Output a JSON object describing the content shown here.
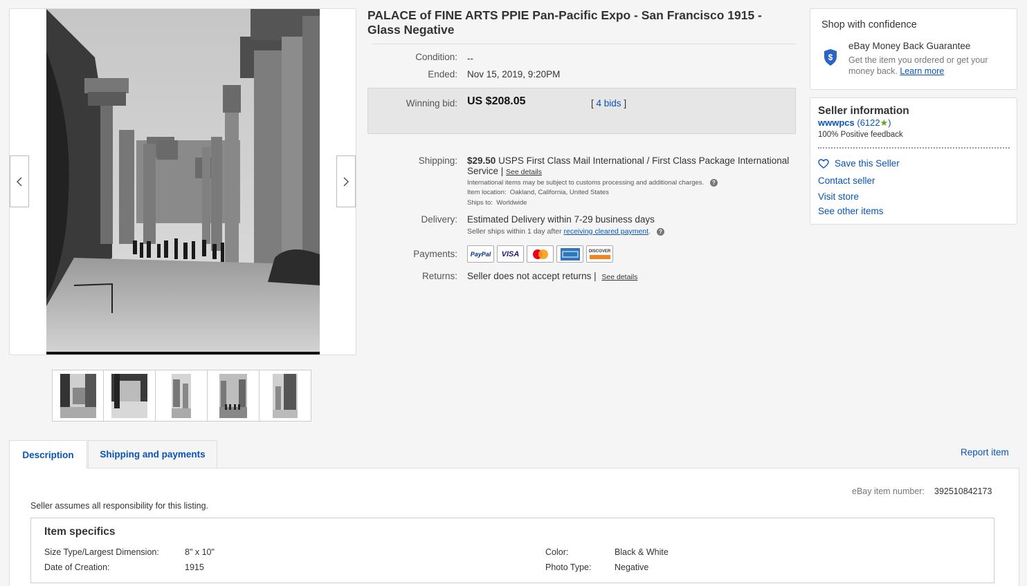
{
  "title": "PALACE of FINE ARTS PPIE Pan-Pacific Expo - San Francisco 1915 - Glass Negative",
  "details": {
    "condition_label": "Condition:",
    "condition_value": "--",
    "ended_label": "Ended:",
    "ended_value": "Nov 15, 2019, 9:20PM",
    "winning_bid_label": "Winning bid:",
    "winning_bid_value": "US $208.05",
    "bids_link": "4 bids",
    "bids_open": "[",
    "bids_close": "]",
    "shipping_label": "Shipping:",
    "shipping_cost": "$29.50",
    "shipping_service_line1": "USPS First Class Mail International / First Class Package International",
    "shipping_service_line2": "Service |",
    "shipping_see_details": "See details",
    "shipping_note": "International items may be subject to customs processing and additional charges.",
    "item_location_label": "Item location:",
    "item_location_value": "Oakland, California, United States",
    "ships_to_label": "Ships to:",
    "ships_to_value": "Worldwide",
    "delivery_label": "Delivery:",
    "delivery_value": "Estimated Delivery within 7-29 business days",
    "delivery_note_prefix": "Seller ships within 1 day after",
    "delivery_note_link": "receiving cleared payment",
    "delivery_note_suffix": ".",
    "payments_label": "Payments:",
    "returns_label": "Returns:",
    "returns_value": "Seller does not accept returns |",
    "returns_see_details": "See details"
  },
  "payments": [
    {
      "name": "PayPal",
      "icon": "paypal-icon",
      "color": "#003087"
    },
    {
      "name": "VISA",
      "icon": "visa-icon",
      "color": "#1a1f71"
    },
    {
      "name": "",
      "icon": "mastercard-icon",
      "color": "#eb001b"
    },
    {
      "name": "",
      "icon": "amex-icon",
      "color": "#2e77bb"
    },
    {
      "name": "DISCOVER",
      "icon": "discover-icon",
      "color": "#f58220"
    }
  ],
  "confidence": {
    "heading": "Shop with confidence",
    "guarantee_title": "eBay Money Back Guarantee",
    "guarantee_text1": "Get the item you ordered or get your",
    "guarantee_text2": "money back.",
    "learn_more": "Learn more"
  },
  "seller": {
    "heading": "Seller information",
    "username": "wwwpcs",
    "score_open": "(6122",
    "score_close": ")",
    "feedback": "100% Positive feedback",
    "save_seller": "Save this Seller",
    "contact": "Contact seller",
    "visit_store": "Visit store",
    "other_items": "See other items"
  },
  "tabs": {
    "description": "Description",
    "shipping": "Shipping and payments",
    "report": "Report item"
  },
  "description": {
    "item_number_label": "eBay item number:",
    "item_number": "392510842173",
    "responsibility": "Seller assumes all responsibility for this listing.",
    "specifics_heading": "Item specifics",
    "specifics": [
      {
        "label": "Size Type/Largest Dimension:",
        "value": "8\" x 10\""
      },
      {
        "label": "Date of Creation:",
        "value": "1915"
      },
      {
        "label": "Color:",
        "value": "Black & White"
      },
      {
        "label": "Photo Type:",
        "value": "Negative"
      }
    ]
  },
  "colors": {
    "link": "#0654ba",
    "star": "#5ba71b",
    "shield": "#2b64c4"
  }
}
